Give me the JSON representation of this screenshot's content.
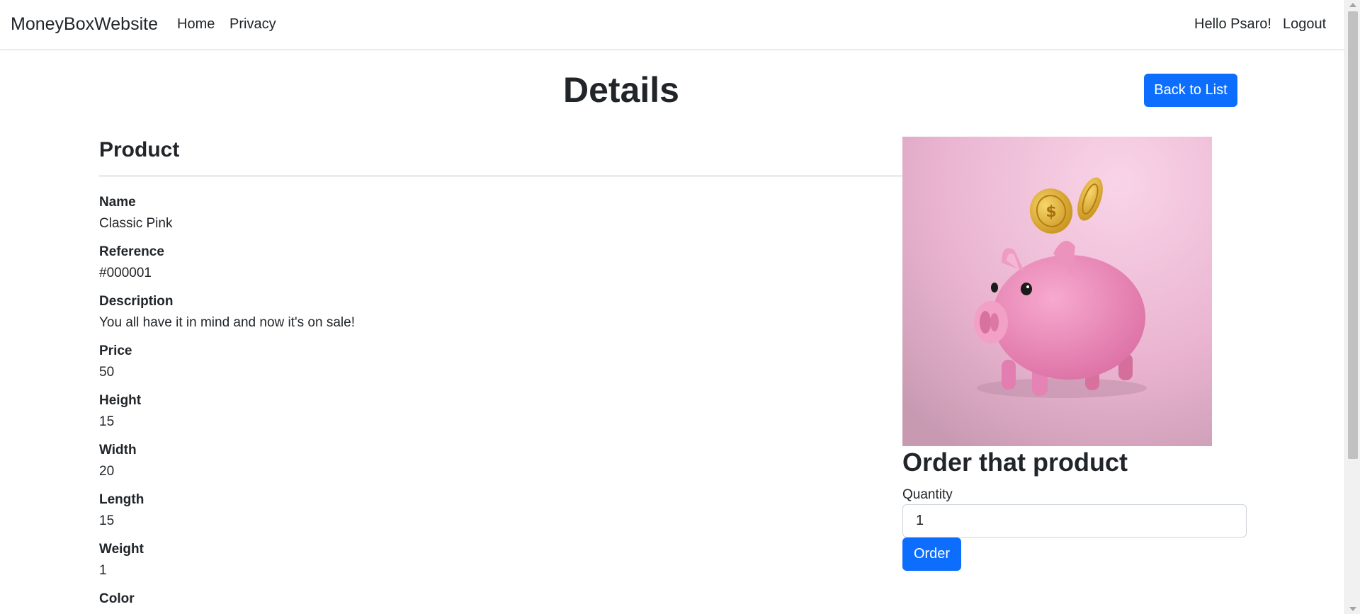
{
  "navbar": {
    "brand": "MoneyBoxWebsite",
    "links": [
      "Home",
      "Privacy"
    ],
    "greeting": "Hello Psaro!",
    "logout": "Logout"
  },
  "page": {
    "title": "Details",
    "back_button": "Back to List"
  },
  "product": {
    "heading": "Product",
    "fields": [
      {
        "label": "Name",
        "value": "Classic Pink"
      },
      {
        "label": "Reference",
        "value": "#000001"
      },
      {
        "label": "Description",
        "value": "You all have it in mind and now it's on sale!"
      },
      {
        "label": "Price",
        "value": "50"
      },
      {
        "label": "Height",
        "value": "15"
      },
      {
        "label": "Width",
        "value": "20"
      },
      {
        "label": "Length",
        "value": "15"
      },
      {
        "label": "Weight",
        "value": "1"
      },
      {
        "label": "Color",
        "value": ""
      }
    ]
  },
  "image": {
    "subject": "pink-piggy-bank-with-gold-coins"
  },
  "order": {
    "heading": "Order that product",
    "quantity_label": "Quantity",
    "quantity_value": "1",
    "button": "Order"
  },
  "colors": {
    "primary": "#0d6efd",
    "text": "#212529",
    "image_bg": "#e9b3cf",
    "pig": "#ee93bd",
    "coin": "#e4b63a"
  }
}
